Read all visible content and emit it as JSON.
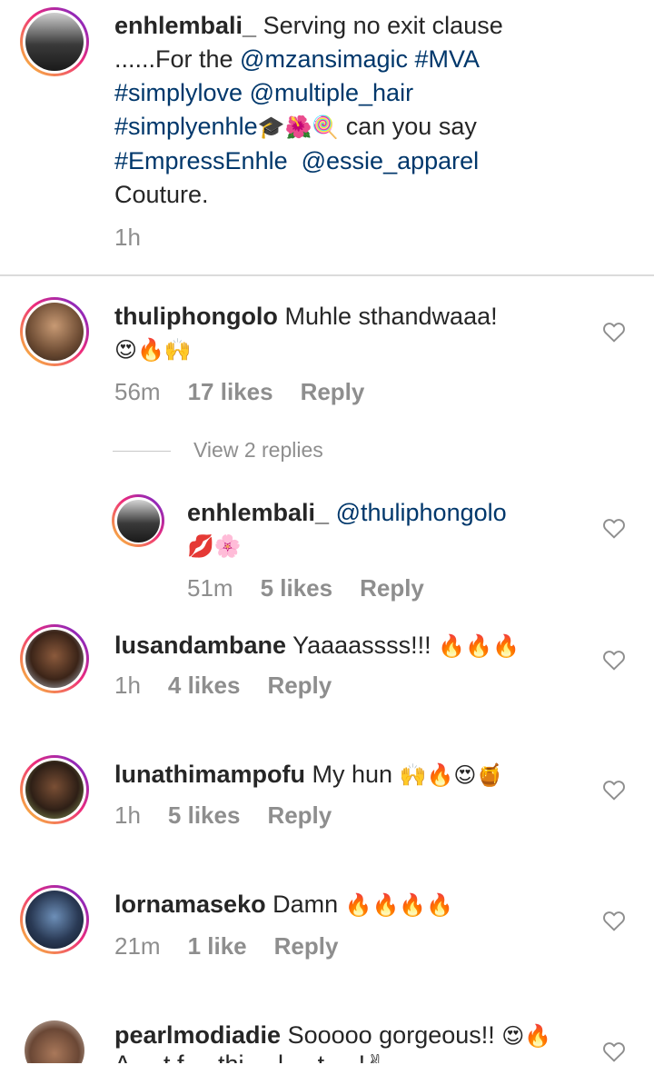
{
  "caption": {
    "username": "enhlembali_",
    "line1_text": "Serving no exit clause",
    "line2_dots": "......For the ",
    "line2_mention": "@mzansimagic",
    "line2_tag": "#MVA",
    "line3_tag": "#simplylove",
    "line3_mention": "@multiple_hair",
    "line4_tag": "#simplyenhle",
    "line4_emojis": "🎓🌺🍭",
    "line4_text": " can you say",
    "line5_tag": "#EmpressEnhle",
    "line5_mention": "@essie_apparel",
    "line6_text": "Couture.",
    "time": "1h"
  },
  "comments": [
    {
      "username": "thuliphongolo",
      "text": "Muhle sthandwaaa!",
      "emojis": "😍🔥🙌",
      "time": "56m",
      "likes": "17 likes",
      "reply": "Reply",
      "view_replies": "View 2 replies",
      "replies": [
        {
          "username": "enhlembali_",
          "mention": "@thuliphongolo",
          "emojis": "💋🌸",
          "time": "51m",
          "likes": "5 likes",
          "reply": "Reply"
        }
      ]
    },
    {
      "username": "lusandambane",
      "text": "Yaaaassss!!!",
      "emojis": "🔥🔥🔥",
      "time": "1h",
      "likes": "4 likes",
      "reply": "Reply"
    },
    {
      "username": "lunathimampofu",
      "text": "My hun",
      "emojis": "🙌🔥😍🍯",
      "time": "1h",
      "likes": "5 likes",
      "reply": "Reply"
    },
    {
      "username": "lornamaseko",
      "text": "Damn",
      "emojis": "🔥🔥🔥🔥",
      "time": "21m",
      "likes": "1 like",
      "reply": "Reply"
    },
    {
      "username": "pearlmodiadie",
      "text": "Sooooo gorgeous!!",
      "emojis": "😍🔥",
      "next_line": "A ... t f ... thi ... l ... t ... !✌"
    }
  ],
  "colors": {
    "link": "#00376b",
    "meta": "#8e8e8e",
    "ring_start": "#f9ce34",
    "ring_end": "#6228d7"
  },
  "icons": [
    "heart-outline-icon"
  ]
}
